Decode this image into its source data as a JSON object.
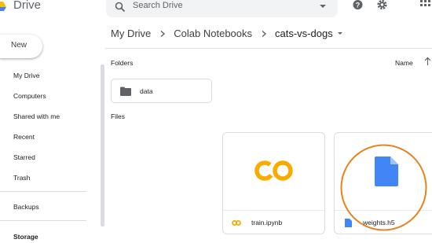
{
  "app": {
    "name": "Drive"
  },
  "search": {
    "placeholder": "Search Drive"
  },
  "header_icons": [
    "help-icon",
    "settings-icon",
    "apps-grid-icon"
  ],
  "sidebar": {
    "new_label": "New",
    "items": [
      {
        "label": "My Drive"
      },
      {
        "label": "Computers"
      },
      {
        "label": "Shared with me"
      },
      {
        "label": "Recent"
      },
      {
        "label": "Starred"
      },
      {
        "label": "Trash"
      }
    ],
    "backups_label": "Backups",
    "storage_label": "Storage"
  },
  "breadcrumb": {
    "items": [
      "My Drive",
      "Colab Notebooks",
      "cats-vs-dogs"
    ]
  },
  "main": {
    "folders_label": "Folders",
    "files_label": "Files",
    "sort_label": "Name",
    "folders": [
      {
        "name": "data"
      }
    ],
    "files": [
      {
        "name": "train.ipynb",
        "preview_text": "CO",
        "type": "colab-notebook"
      },
      {
        "name": "weights.h5",
        "type": "generic-file"
      }
    ]
  },
  "colors": {
    "accent_blue": "#4285f4",
    "colab_yellow": "#f9ab00",
    "highlight_orange": "#e8821e",
    "folder_gray": "#5f6368"
  }
}
